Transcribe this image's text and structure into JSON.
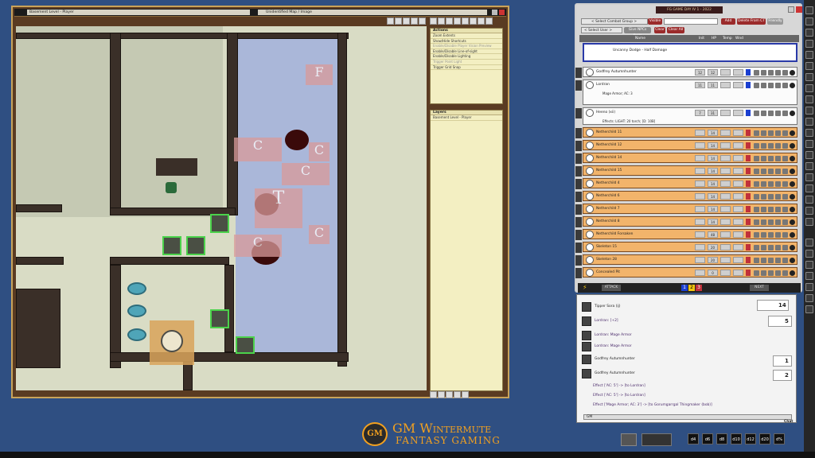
{
  "map_window": {
    "left_title": "Basement Level - Player",
    "right_title": "Unidentified Map / Image",
    "labels": {
      "f": "F",
      "c": "C",
      "t": "T"
    },
    "token_label": "GM",
    "actions_title": "Actions",
    "actions": [
      {
        "label": "Zoom Extents",
        "dim": false
      },
      {
        "label": "Show/Hide Shortcuts",
        "dim": false
      },
      {
        "label": "Enable/Disable Player Vision Preview",
        "dim": true
      },
      {
        "label": "Enable/Disable Line-of-sight",
        "dim": false
      },
      {
        "label": "Enable/Disable Lighting",
        "dim": false
      },
      {
        "label": "Trigger Point Light",
        "dim": true
      },
      {
        "label": "Trigger Grid Snap",
        "dim": false
      }
    ],
    "layers_title": "Layers",
    "layer_item": "Basement Level - Player"
  },
  "ct": {
    "title": "FG GAME DAY IV 1 - 2022",
    "select_group": "< Select Combat Group >",
    "visible_label": "Visible",
    "add_label": "Add",
    "delete_label": "Delete From CT",
    "friendly_label": "Friendly",
    "select_user": "< Select User >",
    "give_label": "Give NPCs Rolls",
    "clear_label": "Clear",
    "clear_all_label": "Clear All",
    "col_name": "Name",
    "col_init": "Init",
    "col_hp": "HP",
    "col_temp": "Temp",
    "col_wnd": "Wnd",
    "top_effect": "Uncanny Dodge - Half Damage",
    "rows": [
      {
        "name": "Godfrey Autumnhunter",
        "init": "12",
        "hp": "12",
        "style": "w"
      },
      {
        "name": "Lordran",
        "init": "11",
        "hp": "11",
        "style": "w",
        "effect": "Mage Armor; AC: 3"
      },
      {
        "name": "Heeno (xii)",
        "init": "7",
        "hp": "31",
        "style": "w",
        "effect": "Effects: LIGHT: 20 torch; [D: 10B]"
      },
      {
        "name": "Netherchild 11",
        "init": "",
        "hp": "14",
        "style": "o"
      },
      {
        "name": "Netherchild 12",
        "init": "",
        "hp": "14",
        "style": "o"
      },
      {
        "name": "Netherchild 14",
        "init": "",
        "hp": "14",
        "style": "o"
      },
      {
        "name": "Netherchild 15",
        "init": "",
        "hp": "14",
        "style": "o"
      },
      {
        "name": "Netherchild 4",
        "init": "",
        "hp": "14",
        "style": "o"
      },
      {
        "name": "Netherchild 6",
        "init": "",
        "hp": "14",
        "style": "o"
      },
      {
        "name": "Netherchild 7",
        "init": "",
        "hp": "14",
        "style": "o"
      },
      {
        "name": "Netherchild 8",
        "init": "",
        "hp": "14",
        "style": "o"
      },
      {
        "name": "Netherchild Forsaken",
        "init": "",
        "hp": "48",
        "style": "o"
      },
      {
        "name": "Skeleton 15",
        "init": "",
        "hp": "20",
        "style": "o"
      },
      {
        "name": "Skeleton 28",
        "init": "",
        "hp": "20",
        "style": "o"
      },
      {
        "name": "Concealed Pit",
        "init": "",
        "hp": "0",
        "style": "o"
      }
    ],
    "round_label": "ATTACK",
    "round_digits": [
      "1",
      "2",
      "3"
    ],
    "next_label": "NEXT"
  },
  "chat": {
    "lines": [
      {
        "text": "Tipper Sora (ij)",
        "avatar": true,
        "bold": true
      },
      {
        "text": "Lordran: [+2]",
        "avatar": true,
        "bold": false
      },
      {
        "text": "Lordran: Mage Armor",
        "avatar": true,
        "bold": false
      },
      {
        "text": "Lordran: Mage Armor",
        "avatar": true,
        "bold": false
      },
      {
        "text": "Godfrey Autumnhunter",
        "avatar": true,
        "bold": true
      },
      {
        "text": "Godfrey Autumnhunter",
        "avatar": true,
        "bold": true
      },
      {
        "text": "Effect ['AC: 5'] -> [to Lordran]",
        "avatar": false,
        "bold": false
      },
      {
        "text": "Effect ['AC: 5'] -> [to Lordran]",
        "avatar": false,
        "bold": false
      },
      {
        "text": "Effect ['Mage Armor; AC: 3'] -> [to Gorumgarrgal Thingmaker (bob)]",
        "avatar": false,
        "bold": false
      }
    ],
    "roll_values": [
      "14",
      "5",
      "1",
      "2"
    ],
    "input_value": "GM",
    "chat_label": "Chat"
  },
  "logo": {
    "title": "GM Wintermute",
    "subtitle": "FANTASY GAMING",
    "badge": "GM"
  },
  "dice": [
    "d4",
    "d6",
    "d8",
    "d10",
    "d12",
    "d20",
    "d%"
  ]
}
